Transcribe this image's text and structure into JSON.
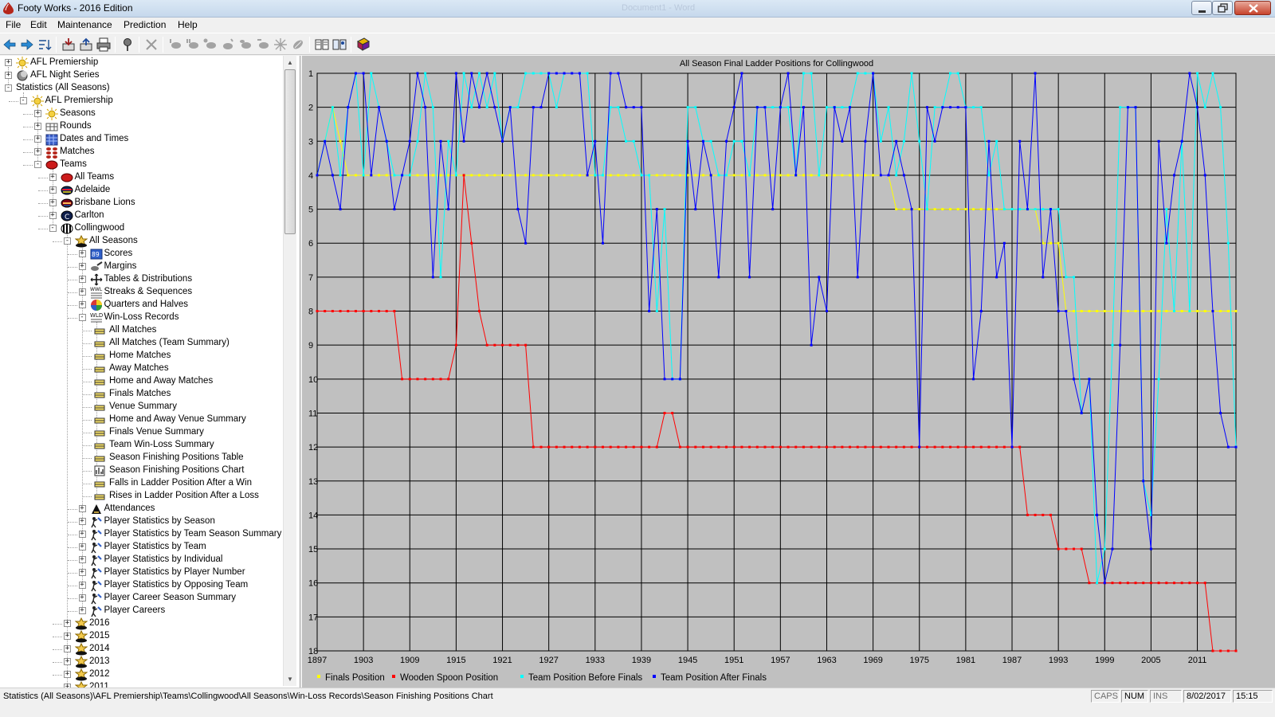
{
  "window": {
    "title": "Footy Works - 2016 Edition",
    "ghost_title": "Document1 - Word",
    "colors": {
      "titlebar": "#c6d8ec",
      "close": "#c7432c"
    }
  },
  "menu": [
    "File",
    "Edit",
    "Maintenance",
    "Prediction",
    "Help"
  ],
  "toolbar": {
    "icons": [
      "back-arrow-icon",
      "forward-arrow-icon",
      "tree-sort-icon",
      "import-icon",
      "export-icon",
      "print-icon",
      "pin-icon",
      "delete-icon",
      "football-1-icon",
      "football-2-icon",
      "football-3-icon",
      "football-4-icon",
      "football-5-icon",
      "football-6-icon",
      "football-7-icon",
      "football-8-icon",
      "book-icon",
      "book-open-icon",
      "book-red-icon"
    ]
  },
  "tree": [
    {
      "label": "AFL Premiership",
      "depth": 0,
      "state": "+",
      "icon": "sun-icon"
    },
    {
      "label": "AFL Night Series",
      "depth": 0,
      "state": "+",
      "icon": "moon-icon"
    },
    {
      "label": "Statistics (All Seasons)",
      "depth": 0,
      "state": "-",
      "icon": "none"
    },
    {
      "label": "AFL Premiership",
      "depth": 1,
      "state": "-",
      "icon": "sun-icon"
    },
    {
      "label": "Seasons",
      "depth": 2,
      "state": "+",
      "icon": "sun-icon"
    },
    {
      "label": "Rounds",
      "depth": 2,
      "state": "+",
      "icon": "rounds-icon"
    },
    {
      "label": "Dates and Times",
      "depth": 2,
      "state": "+",
      "icon": "calendar-icon"
    },
    {
      "label": "Matches",
      "depth": 2,
      "state": "+",
      "icon": "matches-icon"
    },
    {
      "label": "Teams",
      "depth": 2,
      "state": "-",
      "icon": "football-red-icon"
    },
    {
      "label": "All Teams",
      "depth": 3,
      "state": "+",
      "icon": "football-red-icon"
    },
    {
      "label": "Adelaide",
      "depth": 3,
      "state": "+",
      "icon": "adelaide-icon"
    },
    {
      "label": "Brisbane Lions",
      "depth": 3,
      "state": "+",
      "icon": "brisbane-icon"
    },
    {
      "label": "Carlton",
      "depth": 3,
      "state": "+",
      "icon": "carlton-icon"
    },
    {
      "label": "Collingwood",
      "depth": 3,
      "state": "-",
      "icon": "collingwood-icon"
    },
    {
      "label": "All Seasons",
      "depth": 4,
      "state": "-",
      "icon": "seasons-icon"
    },
    {
      "label": "Scores",
      "depth": 5,
      "state": "+",
      "icon": "scores-icon"
    },
    {
      "label": "Margins",
      "depth": 5,
      "state": "+",
      "icon": "margins-icon"
    },
    {
      "label": "Tables & Distributions",
      "depth": 5,
      "state": "+",
      "icon": "distribution-icon"
    },
    {
      "label": "Streaks & Sequences",
      "depth": 5,
      "state": "+",
      "icon": "streaks-icon"
    },
    {
      "label": "Quarters and Halves",
      "depth": 5,
      "state": "+",
      "icon": "quarters-icon"
    },
    {
      "label": "Win-Loss Records",
      "depth": 5,
      "state": "-",
      "icon": "winloss-icon"
    },
    {
      "label": "All Matches",
      "depth": 6,
      "state": "",
      "icon": "table-icon"
    },
    {
      "label": "All Matches (Team Summary)",
      "depth": 6,
      "state": "",
      "icon": "table-icon"
    },
    {
      "label": "Home Matches",
      "depth": 6,
      "state": "",
      "icon": "table-icon"
    },
    {
      "label": "Away Matches",
      "depth": 6,
      "state": "",
      "icon": "table-icon"
    },
    {
      "label": "Home and Away Matches",
      "depth": 6,
      "state": "",
      "icon": "table-icon"
    },
    {
      "label": "Finals Matches",
      "depth": 6,
      "state": "",
      "icon": "table-icon"
    },
    {
      "label": "Venue Summary",
      "depth": 6,
      "state": "",
      "icon": "table-icon"
    },
    {
      "label": "Home and Away Venue Summary",
      "depth": 6,
      "state": "",
      "icon": "table-icon"
    },
    {
      "label": "Finals Venue Summary",
      "depth": 6,
      "state": "",
      "icon": "table-icon"
    },
    {
      "label": "Team Win-Loss Summary",
      "depth": 6,
      "state": "",
      "icon": "table-icon"
    },
    {
      "label": "Season Finishing Positions Table",
      "depth": 6,
      "state": "",
      "icon": "table-icon"
    },
    {
      "label": "Season Finishing Positions Chart",
      "depth": 6,
      "state": "",
      "icon": "chart-icon"
    },
    {
      "label": "Falls in Ladder Position After a Win",
      "depth": 6,
      "state": "",
      "icon": "table-icon"
    },
    {
      "label": "Rises in Ladder Position After a Loss",
      "depth": 6,
      "state": "",
      "icon": "table-icon"
    },
    {
      "label": "Attendances",
      "depth": 5,
      "state": "+",
      "icon": "attendance-icon"
    },
    {
      "label": "Player Statistics by Season",
      "depth": 5,
      "state": "+",
      "icon": "player-icon"
    },
    {
      "label": "Player Statistics by Team Season Summary",
      "depth": 5,
      "state": "+",
      "icon": "player-icon"
    },
    {
      "label": "Player Statistics by Team",
      "depth": 5,
      "state": "+",
      "icon": "player-icon"
    },
    {
      "label": "Player Statistics by Individual",
      "depth": 5,
      "state": "+",
      "icon": "player-icon"
    },
    {
      "label": "Player Statistics by Player Number",
      "depth": 5,
      "state": "+",
      "icon": "player-icon"
    },
    {
      "label": "Player Statistics by Opposing Team",
      "depth": 5,
      "state": "+",
      "icon": "player-icon"
    },
    {
      "label": "Player Career Season Summary",
      "depth": 5,
      "state": "+",
      "icon": "player-icon"
    },
    {
      "label": "Player Careers",
      "depth": 5,
      "state": "+",
      "icon": "player-icon"
    },
    {
      "label": "2016",
      "depth": 4,
      "state": "+",
      "icon": "season-year-icon"
    },
    {
      "label": "2015",
      "depth": 4,
      "state": "+",
      "icon": "season-year-icon"
    },
    {
      "label": "2014",
      "depth": 4,
      "state": "+",
      "icon": "season-year-icon"
    },
    {
      "label": "2013",
      "depth": 4,
      "state": "+",
      "icon": "season-year-icon"
    },
    {
      "label": "2012",
      "depth": 4,
      "state": "+",
      "icon": "season-year-icon"
    },
    {
      "label": "2011",
      "depth": 4,
      "state": "+",
      "icon": "season-year-icon"
    }
  ],
  "status": {
    "path": "Statistics (All Seasons)\\AFL Premiership\\Teams\\Collingwood\\All Seasons\\Win-Loss Records\\Season Finishing Positions Chart",
    "caps": "CAPS",
    "num": "NUM",
    "ins": "INS",
    "date": "8/02/2017",
    "time": "15:15"
  },
  "chart_data": {
    "type": "line",
    "title": "All Season Final Ladder Positions for Collingwood",
    "xlim": [
      1897,
      2016
    ],
    "ylim": [
      1,
      18
    ],
    "y_inverted": true,
    "grid": true,
    "legend_position": "bottom",
    "x_ticks": [
      1897,
      1903,
      1909,
      1915,
      1921,
      1927,
      1933,
      1939,
      1945,
      1951,
      1957,
      1963,
      1969,
      1975,
      1981,
      1987,
      1993,
      1999,
      2005,
      2011
    ],
    "y_ticks": [
      1,
      2,
      3,
      4,
      5,
      6,
      7,
      8,
      9,
      10,
      11,
      12,
      13,
      14,
      15,
      16,
      17,
      18
    ],
    "x": [
      1897,
      1898,
      1899,
      1900,
      1901,
      1902,
      1903,
      1904,
      1905,
      1906,
      1907,
      1908,
      1909,
      1910,
      1911,
      1912,
      1913,
      1914,
      1915,
      1916,
      1917,
      1918,
      1919,
      1920,
      1921,
      1922,
      1923,
      1924,
      1925,
      1926,
      1927,
      1928,
      1929,
      1930,
      1931,
      1932,
      1933,
      1934,
      1935,
      1936,
      1937,
      1938,
      1939,
      1940,
      1941,
      1942,
      1943,
      1944,
      1945,
      1946,
      1947,
      1948,
      1949,
      1950,
      1951,
      1952,
      1953,
      1954,
      1955,
      1956,
      1957,
      1958,
      1959,
      1960,
      1961,
      1962,
      1963,
      1964,
      1965,
      1966,
      1967,
      1968,
      1969,
      1970,
      1971,
      1972,
      1973,
      1974,
      1975,
      1976,
      1977,
      1978,
      1979,
      1980,
      1981,
      1982,
      1983,
      1984,
      1985,
      1986,
      1987,
      1988,
      1989,
      1990,
      1991,
      1992,
      1993,
      1994,
      1995,
      1996,
      1997,
      1998,
      1999,
      2000,
      2001,
      2002,
      2003,
      2004,
      2005,
      2006,
      2007,
      2008,
      2009,
      2010,
      2011,
      2012,
      2013,
      2014,
      2015,
      2016
    ],
    "series": [
      {
        "name": "Finals Position",
        "color": "#ffff00",
        "values": [
          4,
          3,
          2,
          3,
          4,
          4,
          4,
          4,
          4,
          4,
          4,
          4,
          4,
          4,
          4,
          4,
          4,
          4,
          4,
          4,
          4,
          4,
          4,
          4,
          4,
          4,
          4,
          4,
          4,
          4,
          4,
          4,
          4,
          4,
          4,
          4,
          4,
          4,
          4,
          4,
          4,
          4,
          4,
          4,
          4,
          4,
          4,
          4,
          4,
          4,
          4,
          4,
          4,
          4,
          4,
          4,
          4,
          4,
          4,
          4,
          4,
          4,
          4,
          4,
          4,
          4,
          4,
          4,
          4,
          4,
          4,
          4,
          4,
          4,
          4,
          5,
          5,
          5,
          5,
          5,
          5,
          5,
          5,
          5,
          5,
          5,
          5,
          5,
          5,
          5,
          5,
          5,
          5,
          5,
          6,
          6,
          6,
          8,
          8,
          8,
          8,
          8,
          8,
          8,
          8,
          8,
          8,
          8,
          8,
          8,
          8,
          8,
          8,
          8,
          8,
          8,
          8,
          8,
          8,
          8
        ]
      },
      {
        "name": "Wooden Spoon Position",
        "color": "#ff0000",
        "values": [
          8,
          8,
          8,
          8,
          8,
          8,
          8,
          8,
          8,
          8,
          8,
          10,
          10,
          10,
          10,
          10,
          10,
          10,
          9,
          4,
          6,
          8,
          9,
          9,
          9,
          9,
          9,
          9,
          12,
          12,
          12,
          12,
          12,
          12,
          12,
          12,
          12,
          12,
          12,
          12,
          12,
          12,
          12,
          12,
          12,
          11,
          11,
          12,
          12,
          12,
          12,
          12,
          12,
          12,
          12,
          12,
          12,
          12,
          12,
          12,
          12,
          12,
          12,
          12,
          12,
          12,
          12,
          12,
          12,
          12,
          12,
          12,
          12,
          12,
          12,
          12,
          12,
          12,
          12,
          12,
          12,
          12,
          12,
          12,
          12,
          12,
          12,
          12,
          12,
          12,
          12,
          12,
          14,
          14,
          14,
          14,
          15,
          15,
          15,
          15,
          16,
          16,
          16,
          16,
          16,
          16,
          16,
          16,
          16,
          16,
          16,
          16,
          16,
          16,
          16,
          16,
          18,
          18,
          18,
          18
        ]
      },
      {
        "name": "Team Position Before Finals",
        "color": "#00ffff",
        "values": [
          4,
          3,
          2,
          4,
          2,
          1,
          4,
          1,
          2,
          3,
          4,
          4,
          4,
          3,
          1,
          2,
          7,
          3,
          4,
          1,
          2,
          1,
          2,
          1,
          3,
          2,
          2,
          1,
          1,
          1,
          1,
          2,
          1,
          1,
          1,
          1,
          4,
          4,
          2,
          2,
          3,
          3,
          4,
          4,
          8,
          5,
          10,
          10,
          2,
          2,
          3,
          3,
          4,
          4,
          3,
          3,
          4,
          2,
          2,
          2,
          2,
          2,
          4,
          1,
          1,
          4,
          2,
          2,
          2,
          2,
          1,
          1,
          1,
          3,
          2,
          4,
          3,
          1,
          3,
          5,
          2,
          2,
          1,
          1,
          2,
          2,
          2,
          4,
          3,
          5,
          5,
          5,
          5,
          5,
          5,
          5,
          5,
          7,
          7,
          11,
          10,
          16,
          15,
          9,
          2,
          2,
          2,
          13,
          14,
          10,
          5,
          8,
          3,
          8,
          1,
          2,
          1,
          2,
          6,
          12
        ]
      },
      {
        "name": "Team Position After Finals",
        "color": "#0000ff",
        "values": [
          4,
          3,
          4,
          5,
          2,
          1,
          1,
          4,
          2,
          3,
          5,
          4,
          3,
          1,
          2,
          7,
          3,
          5,
          1,
          3,
          1,
          2,
          1,
          2,
          3,
          2,
          5,
          6,
          2,
          2,
          1,
          1,
          1,
          1,
          1,
          4,
          3,
          6,
          1,
          1,
          2,
          2,
          2,
          8,
          5,
          10,
          10,
          10,
          3,
          5,
          3,
          4,
          7,
          3,
          2,
          1,
          7,
          2,
          2,
          5,
          2,
          1,
          4,
          2,
          9,
          7,
          8,
          2,
          3,
          2,
          7,
          3,
          1,
          4,
          4,
          3,
          4,
          5,
          12,
          2,
          3,
          2,
          2,
          2,
          2,
          10,
          8,
          3,
          7,
          6,
          12,
          3,
          5,
          1,
          7,
          5,
          8,
          8,
          10,
          11,
          10,
          14,
          16,
          15,
          9,
          2,
          2,
          13,
          15,
          3,
          6,
          4,
          3,
          1,
          2,
          4,
          8,
          11,
          12,
          12
        ]
      }
    ]
  }
}
